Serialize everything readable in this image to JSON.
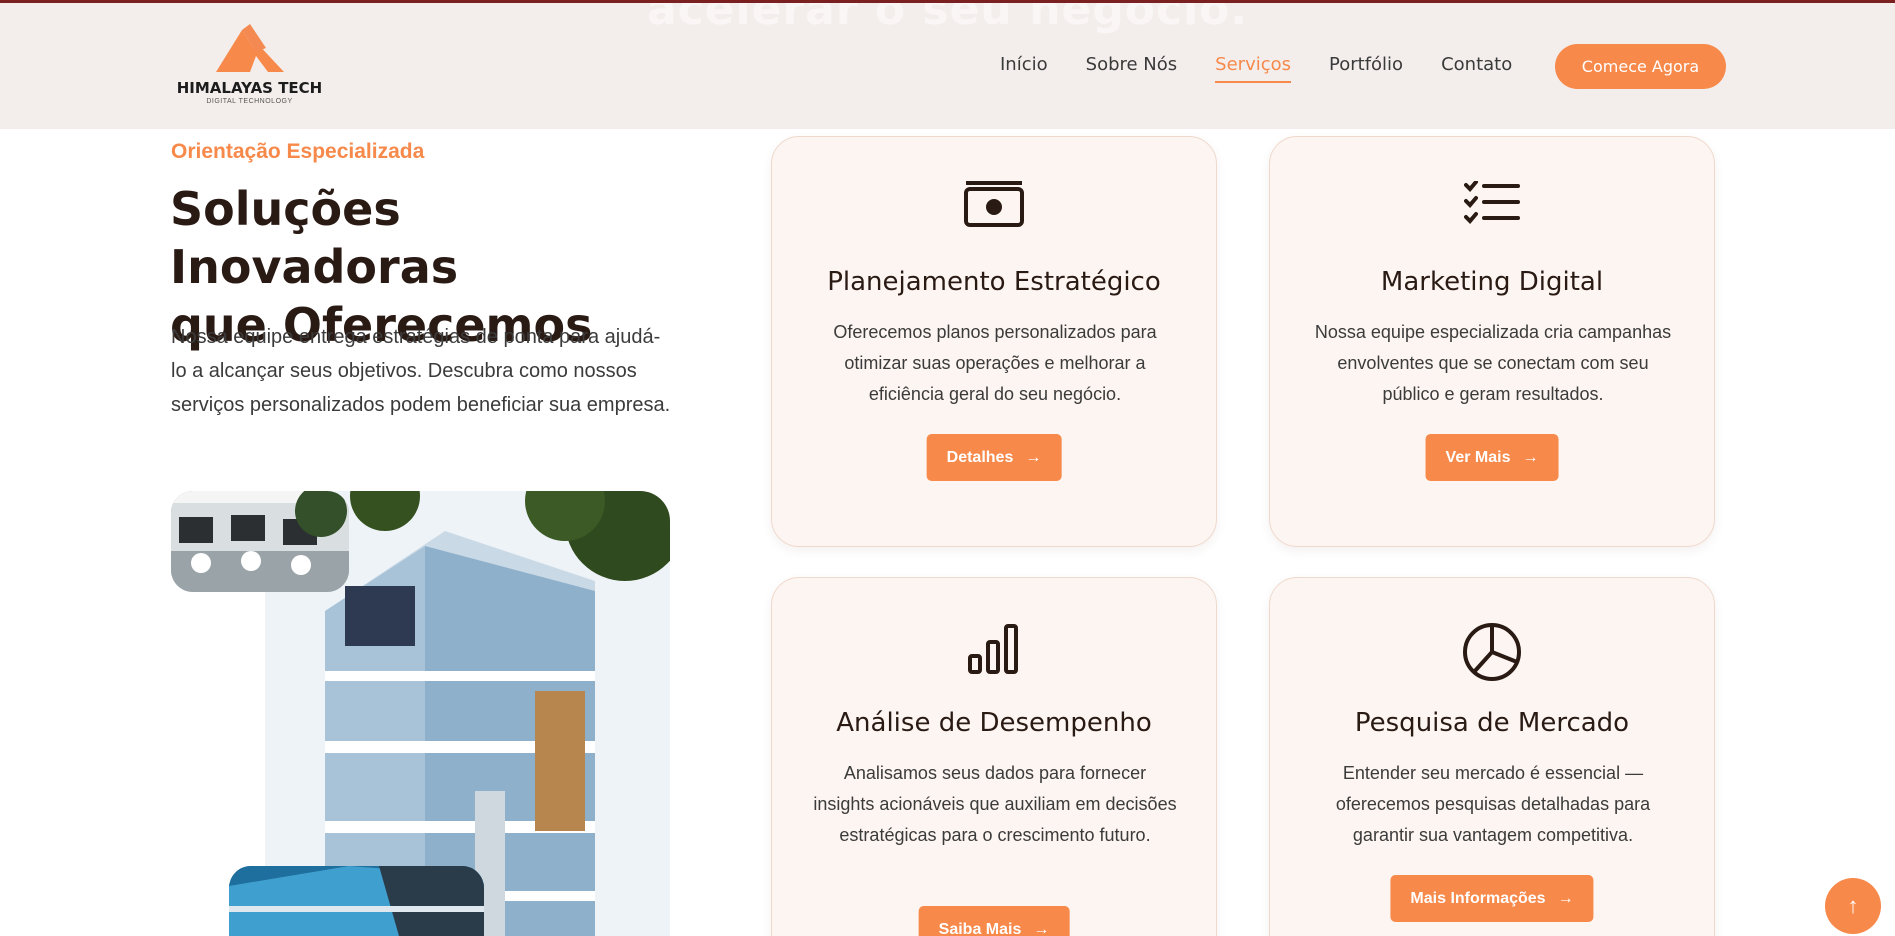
{
  "background_heading": "acelerar o seu negócio.",
  "brand": {
    "name": "HIMALAYAS TECH",
    "tagline": "DIGITAL TECHNOLOGY",
    "accent_color": "#f7894a"
  },
  "nav": {
    "items": [
      "Início",
      "Sobre Nós",
      "Serviços",
      "Portfólio",
      "Contato"
    ],
    "active_item": "Serviços",
    "cta_label": "Comece Agora"
  },
  "intro": {
    "eyebrow": "Orientação Especializada",
    "title_line1": "Soluções Inovadoras",
    "title_line2": "que Oferecemos",
    "body": "Nossa equipe entrega estratégias de ponta para ajudá-lo a alcançar seus objetivos. Descubra como nossos serviços personalizados podem beneficiar sua empresa."
  },
  "services": [
    {
      "icon": "money-icon",
      "title": "Planejamento Estratégico",
      "description": "Oferecemos planos personalizados para otimizar suas operações e melhorar a eficiência geral do seu negócio.",
      "button_label": "Detalhes"
    },
    {
      "icon": "checklist-icon",
      "title": "Marketing Digital",
      "description": "Nossa equipe especializada cria campanhas envolventes que se conectam com seu público e geram resultados.",
      "button_label": "Ver Mais"
    },
    {
      "icon": "bar-chart-icon",
      "title": "Análise de Desempenho",
      "description": "Analisamos seus dados para fornecer insights acionáveis que auxiliam em decisões estratégicas para o crescimento futuro.",
      "button_label": "Saiba Mais"
    },
    {
      "icon": "pie-chart-icon",
      "title": "Pesquisa de Mercado",
      "description": "Entender seu mercado é essencial — oferecemos pesquisas detalhadas para garantir sua vantagem competitiva.",
      "button_label": "Mais Informações"
    }
  ]
}
